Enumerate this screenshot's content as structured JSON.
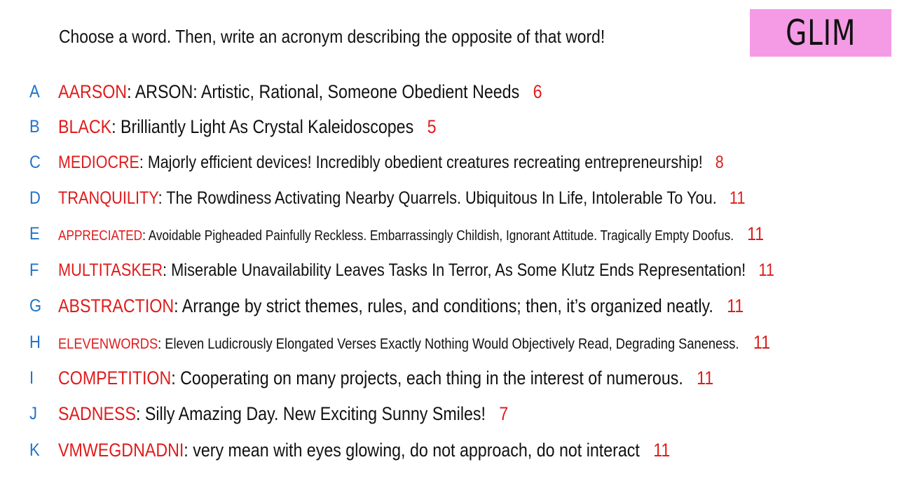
{
  "prompt": "Choose a word. Then, write an acronym describing the opposite of that word!",
  "badge": "GLIM",
  "colors": {
    "letter": "#1f73c9",
    "word": "#e01b1b",
    "description": "#111111",
    "count": "#e01b1b",
    "badge_background": "#f59be6"
  },
  "rows": [
    {
      "letter": "A",
      "word": "AARSON",
      "text": ":  ARSON: Artistic, Rational, Someone Obedient Needs",
      "count": "6"
    },
    {
      "letter": "B",
      "word": "BLACK",
      "text": ":  Brilliantly Light As Crystal Kaleidoscopes",
      "count": "5"
    },
    {
      "letter": "C",
      "word": "MEDIOCRE",
      "text": ":  Majorly efficient devices! Incredibly obedient creatures recreating entrepreneurship!",
      "count": "8"
    },
    {
      "letter": "D",
      "word": "TRANQUILITY",
      "text": ":  The Rowdiness Activating Nearby Quarrels. Ubiquitous In Life, Intolerable To You.",
      "count": "11"
    },
    {
      "letter": "E",
      "word": "APPRECIATED",
      "text": ":  Avoidable Pigheaded Painfully Reckless. Embarrassingly Childish, Ignorant Attitude. Tragically Empty Doofus.",
      "count": "11"
    },
    {
      "letter": "F",
      "word": "MULTITASKER",
      "text": ":  Miserable Unavailability Leaves Tasks In Terror, As Some Klutz Ends Representation!",
      "count": "11"
    },
    {
      "letter": "G",
      "word": "ABSTRACTION",
      "text": ":  Arrange by strict themes, rules, and conditions; then, it’s organized neatly.",
      "count": "11"
    },
    {
      "letter": "H",
      "word": "ELEVENWORDS",
      "text": ":  Eleven Ludicrously Elongated Verses Exactly Nothing Would Objectively Read, Degrading Saneness.",
      "count": "11"
    },
    {
      "letter": "I",
      "word": "COMPETITION",
      "text": ":  Cooperating on many projects, each thing in the interest of numerous.",
      "count": "11"
    },
    {
      "letter": "J",
      "word": "SADNESS",
      "text": ":  Silly Amazing Day. New Exciting Sunny Smiles!",
      "count": "7"
    },
    {
      "letter": "K",
      "word": "VMWEGDNADNI",
      "text": ":  very mean with eyes glowing, do not approach, do not interact",
      "count": "11"
    }
  ]
}
